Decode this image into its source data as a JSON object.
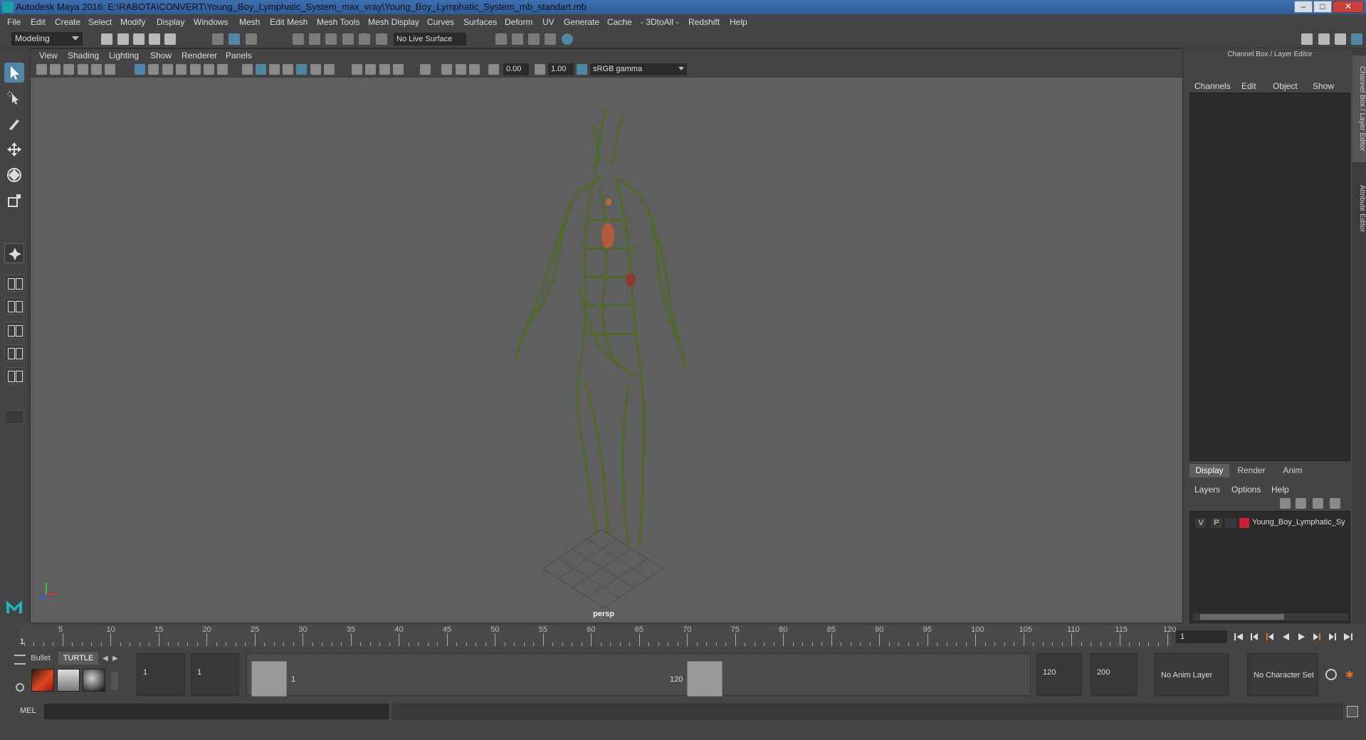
{
  "window": {
    "title": "Autodesk Maya 2016: E:\\RABOTA\\CONVERT\\Young_Boy_Lymphatic_System_max_vray\\Young_Boy_Lymphatic_System_mb_standart.mb",
    "min_label": "–",
    "max_label": "□",
    "close_label": "✕"
  },
  "menubar": [
    "File",
    "Edit",
    "Create",
    "Select",
    "Modify",
    "Display",
    "Windows",
    "Mesh",
    "Edit Mesh",
    "Mesh Tools",
    "Mesh Display",
    "Curves",
    "Surfaces",
    "Deform",
    "UV",
    "Generate",
    "Cache",
    "- 3DtoAll -",
    "Redshift",
    "Help"
  ],
  "statusline": {
    "mode": "Modeling",
    "live_surface": "No Live Surface"
  },
  "viewport": {
    "menus": [
      "View",
      "Shading",
      "Lighting",
      "Show",
      "Renderer",
      "Panels"
    ],
    "exposure": "0.00",
    "gamma": "1.00",
    "color_management": "sRGB gamma",
    "camera": "persp"
  },
  "channel_box": {
    "title": "Channel Box / Layer Editor",
    "menus": [
      "Channels",
      "Edit",
      "Object",
      "Show"
    ]
  },
  "layer_editor": {
    "tabs": [
      "Display",
      "Render",
      "Anim"
    ],
    "active_tab": "Display",
    "menus": [
      "Layers",
      "Options",
      "Help"
    ],
    "layers": [
      {
        "visible": "V",
        "playback": "P",
        "color": "#c8213a",
        "name": "Young_Boy_Lymphatic_Sy"
      }
    ]
  },
  "side_tabs": [
    "Channel Box / Layer Editor",
    "Attribute Editor"
  ],
  "timeslider": {
    "start_label": "1",
    "ticks": [
      "5",
      "10",
      "15",
      "20",
      "25",
      "30",
      "35",
      "40",
      "45",
      "50",
      "55",
      "60",
      "65",
      "70",
      "75",
      "80",
      "85",
      "90",
      "95",
      "100",
      "105",
      "110",
      "115",
      "120"
    ],
    "current_frame": "1"
  },
  "shelf": {
    "tabs": [
      "Bullet",
      "TURTLE"
    ],
    "active_tab": "TURTLE"
  },
  "range": {
    "start_time": "1",
    "playback_start": "1",
    "range_start_label": "1",
    "range_end_label": "120",
    "playback_end": "120",
    "end_time": "200",
    "anim_layer": "No Anim Layer",
    "character_set": "No Character Set"
  },
  "cmdline": {
    "label": "MEL"
  }
}
